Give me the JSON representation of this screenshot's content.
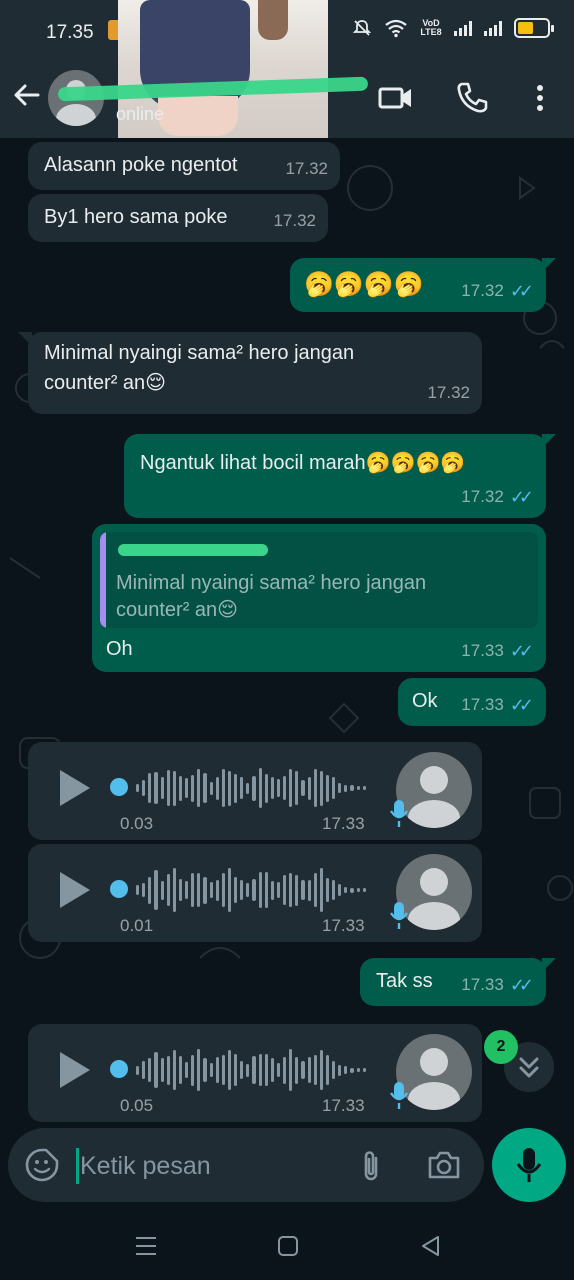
{
  "status_bar": {
    "time": "17.35",
    "network_label": "VoD LTE8",
    "battery_percent": 55
  },
  "header": {
    "contact_status": "online"
  },
  "messages": [
    {
      "dir": "in",
      "text": "Alasann poke ngentot",
      "time": "17.32"
    },
    {
      "dir": "in",
      "text": "By1 hero sama poke",
      "time": "17.32"
    },
    {
      "dir": "out",
      "text": "🥱🥱🥱🥱",
      "time": "17.32"
    },
    {
      "dir": "in",
      "text": "Minimal nyaingi sama² hero jangan\ncounter² an😌",
      "time": "17.32"
    },
    {
      "dir": "out",
      "text": "Ngantuk lihat bocil marah🥱🥱🥱🥱",
      "time": "17.32"
    },
    {
      "dir": "out",
      "quote": "Minimal nyaingi sama² hero jangan\ncounter² an😌",
      "text": "Oh",
      "time": "17.33"
    },
    {
      "dir": "out",
      "text": "Ok",
      "time": "17.33"
    },
    {
      "dir": "in",
      "type": "voice",
      "duration": "0.03",
      "time": "17.33"
    },
    {
      "dir": "in",
      "type": "voice",
      "duration": "0.01",
      "time": "17.33"
    },
    {
      "dir": "out",
      "text": "Tak ss",
      "time": "17.33"
    },
    {
      "dir": "in",
      "type": "voice",
      "duration": "0.05",
      "time": "17.33"
    }
  ],
  "unread_count": "2",
  "input": {
    "placeholder": "Ketik pesan"
  },
  "colors": {
    "chat_bg": "#0b141a",
    "incoming_bubble": "#202c33",
    "outgoing_bubble": "#005c4b",
    "accent": "#00a884",
    "read_tick": "#53bdeb"
  }
}
